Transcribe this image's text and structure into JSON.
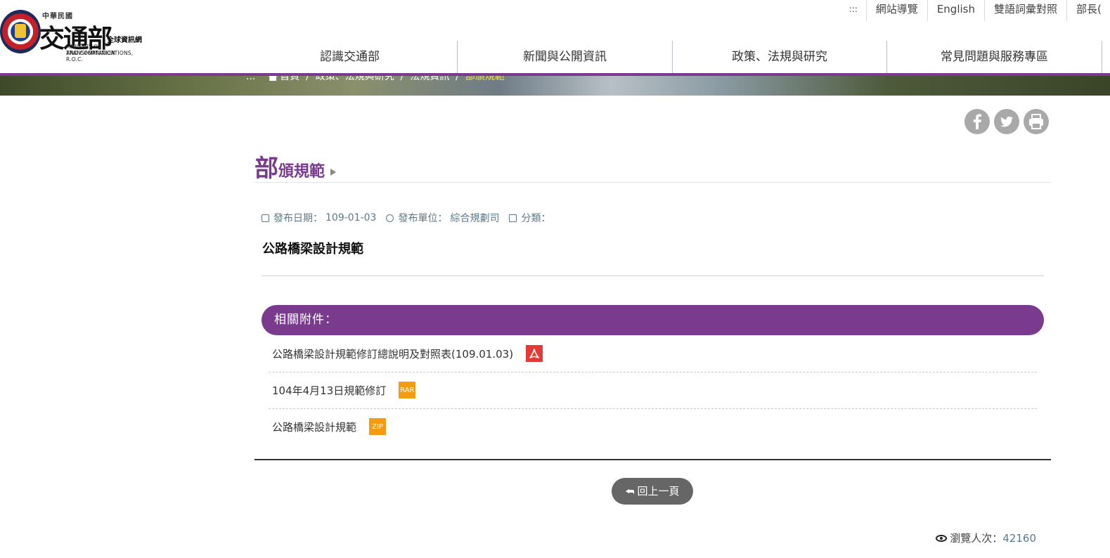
{
  "logo": {
    "roc": "中華民國",
    "name_cn": "交通部",
    "subtitle": "全球資訊網",
    "en_line1": "MINISTRY OF TRANSPORTATION",
    "en_line2": "AND COMMUNICATIONS, R.O.C."
  },
  "topnav": {
    "dots": ":::",
    "items": [
      "網站導覽",
      "English",
      "雙語詞彙對照",
      "部長("
    ]
  },
  "mainnav": {
    "items": [
      "認識交通部",
      "新聞與公開資訊",
      "政策、法規與研究",
      "常見問題與服務專區"
    ]
  },
  "breadcrumb": {
    "dots": "...",
    "items": [
      "首頁",
      "政策、法規與研究",
      "法規資訊"
    ],
    "separator": "/",
    "current": "部頒規範"
  },
  "share": {
    "facebook": "facebook-icon",
    "twitter": "twitter-icon",
    "print": "print-icon"
  },
  "page": {
    "title_first": "部",
    "title_rest": "頒規範"
  },
  "meta": {
    "date_label": "發布日期：",
    "date": "109-01-03",
    "unit_label": "發布單位：",
    "unit": "綜合規劃司",
    "category_label": "分類："
  },
  "document": {
    "title": "公路橋梁設計規範"
  },
  "attachments": {
    "header": "相關附件：",
    "items": [
      {
        "label": "公路橋梁設計規範修訂總說明及對照表(109.01.03)",
        "type": "PDF"
      },
      {
        "label": "104年4月13日規範修訂",
        "type": "RAR"
      },
      {
        "label": "公路橋梁設計規範",
        "type": "ZIP"
      }
    ]
  },
  "back": {
    "label": "回上一頁"
  },
  "views": {
    "label": "瀏覽人次：",
    "count": "42160"
  },
  "colors": {
    "accent": "#7a3b8f",
    "pdf": "#e53935",
    "archive": "#f39c12",
    "meta": "#5a7a8c"
  }
}
